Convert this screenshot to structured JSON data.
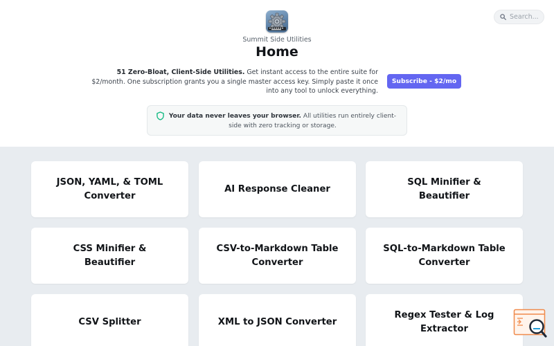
{
  "header": {
    "site_name": "Summit Side Utilities",
    "page_title": "Home",
    "search_placeholder": "Search..."
  },
  "intro": {
    "lead": "51 Zero-Bloat, Client-Side Utilities.",
    "text": " Get instant access to the entire suite for $2/month. One subscription grants you a single master access key. Simply paste it once into any tool to unlock everything."
  },
  "subscribe": {
    "label": "Subscribe - $2/mo"
  },
  "privacy": {
    "lead": "Your data never leaves your browser.",
    "text": " All utilities run entirely client-side with zero tracking or storage."
  },
  "tools": [
    {
      "label": "JSON, YAML, & TOML Converter"
    },
    {
      "label": "AI Response Cleaner"
    },
    {
      "label": "SQL Minifier & Beautifier"
    },
    {
      "label": "CSS Minifier & Beautifier"
    },
    {
      "label": "CSV-to-Markdown Table Converter"
    },
    {
      "label": "SQL-to-Markdown Table Converter"
    },
    {
      "label": "CSV Splitter"
    },
    {
      "label": "XML to JSON Converter"
    },
    {
      "label": "Regex Tester & Log Extractor"
    }
  ],
  "colors": {
    "accent": "#6366f1",
    "grid_background": "#e8ecf0",
    "shield": "#10b981",
    "feedback": "#f08a4b"
  },
  "icons": {
    "logo": "gear-icon",
    "search": "search-icon",
    "privacy": "shield-icon",
    "feedback": "feedback-magnifier-icon"
  }
}
